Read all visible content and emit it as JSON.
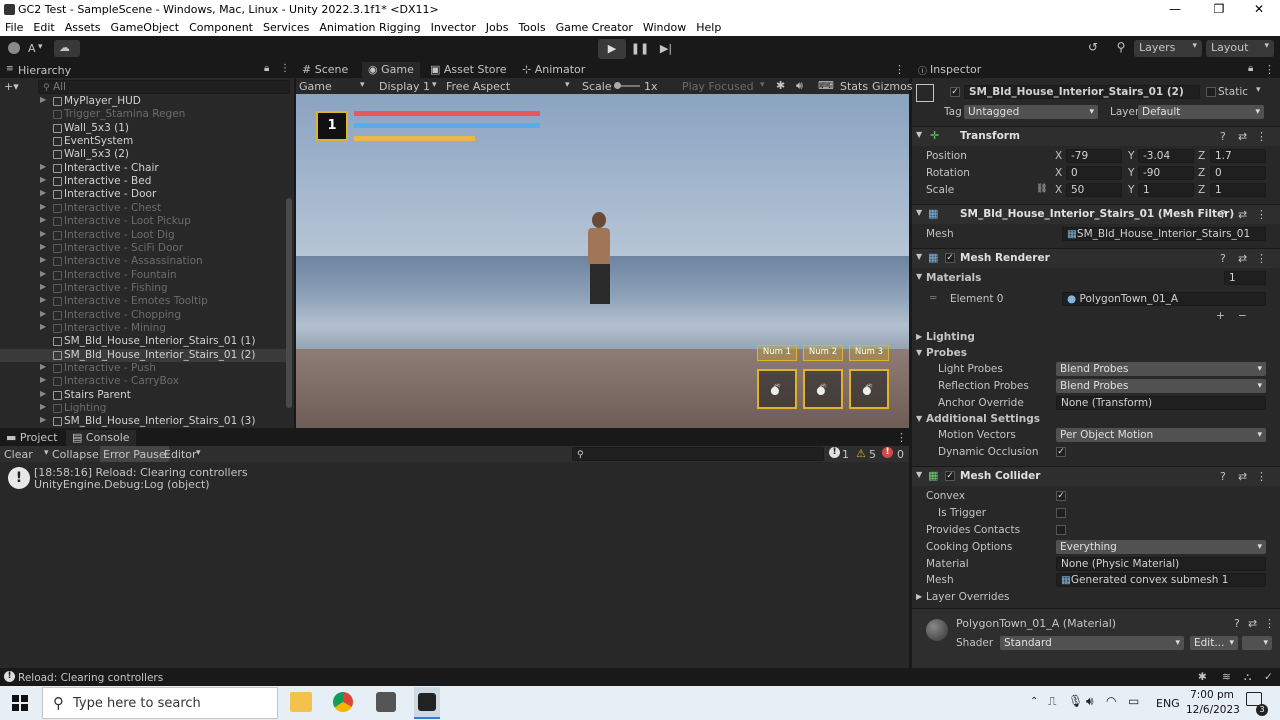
{
  "window": {
    "title": "GC2 Test - SampleScene - Windows, Mac, Linux - Unity 2022.3.1f1* <DX11>"
  },
  "menu": [
    "File",
    "Edit",
    "Assets",
    "GameObject",
    "Component",
    "Services",
    "Animation Rigging",
    "Invector",
    "Jobs",
    "Tools",
    "Game Creator",
    "Window",
    "Help"
  ],
  "toolbar": {
    "account": "A",
    "layers": "Layers",
    "layout": "Layout"
  },
  "hierarchy": {
    "title": "Hierarchy",
    "search_placeholder": "All",
    "items": [
      {
        "label": "MyPlayer_HUD",
        "state": "normal",
        "arrow": true
      },
      {
        "label": "Trigger_Stamina Regen",
        "state": "dim",
        "arrow": false
      },
      {
        "label": "Wall_5x3 (1)",
        "state": "normal",
        "arrow": false
      },
      {
        "label": "EventSystem",
        "state": "normal",
        "arrow": false
      },
      {
        "label": "Wall_5x3 (2)",
        "state": "normal",
        "arrow": false
      },
      {
        "label": "Interactive - Chair",
        "state": "normal",
        "arrow": true
      },
      {
        "label": "Interactive - Bed",
        "state": "normal",
        "arrow": true
      },
      {
        "label": "Interactive - Door",
        "state": "normal",
        "arrow": true
      },
      {
        "label": "Interactive - Chest",
        "state": "dim",
        "arrow": true
      },
      {
        "label": "Interactive - Loot Pickup",
        "state": "dim",
        "arrow": true
      },
      {
        "label": "Interactive - Loot Dig",
        "state": "dim",
        "arrow": true
      },
      {
        "label": "Interactive - SciFi Door",
        "state": "dim",
        "arrow": true
      },
      {
        "label": "Interactive - Assassination",
        "state": "dim",
        "arrow": true
      },
      {
        "label": "Interactive - Fountain",
        "state": "dim",
        "arrow": true
      },
      {
        "label": "Interactive - Fishing",
        "state": "dim",
        "arrow": true
      },
      {
        "label": "Interactive - Emotes Tooltip",
        "state": "dim",
        "arrow": true
      },
      {
        "label": "Interactive - Chopping",
        "state": "dim",
        "arrow": true
      },
      {
        "label": "Interactive - Mining",
        "state": "dim",
        "arrow": true
      },
      {
        "label": "SM_Bld_House_Interior_Stairs_01 (1)",
        "state": "normal",
        "arrow": false
      },
      {
        "label": "SM_Bld_House_Interior_Stairs_01 (2)",
        "state": "selected",
        "arrow": false
      },
      {
        "label": "Interactive - Push",
        "state": "dim",
        "arrow": true
      },
      {
        "label": "Interactive - CarryBox",
        "state": "dim",
        "arrow": true
      },
      {
        "label": "Stairs Parent",
        "state": "normal",
        "arrow": true
      },
      {
        "label": "Lighting",
        "state": "dim",
        "arrow": true
      },
      {
        "label": "SM_Bld_House_Interior_Stairs_01 (3)",
        "state": "normal",
        "arrow": true
      }
    ]
  },
  "center_tabs": [
    "Scene",
    "Game",
    "Asset Store",
    "Animator"
  ],
  "game_bar": {
    "game": "Game",
    "display": "Display 1",
    "aspect": "Free Aspect",
    "scale_label": "Scale",
    "scale_value": "1x",
    "play_focused": "Play Focused",
    "stats": "Stats",
    "gizmos": "Gizmos"
  },
  "hud": {
    "level": "1",
    "health": 1.0,
    "mana": 1.0,
    "stamina": 0.65,
    "hotkeys": [
      "Num 1",
      "Num 2",
      "Num 3"
    ]
  },
  "bottom_tabs": [
    "Project",
    "Console"
  ],
  "console": {
    "clear": "Clear",
    "collapse": "Collapse",
    "error_pause": "Error Pause",
    "editor": "Editor",
    "info_count": "1",
    "warn_count": "5",
    "error_count": "0",
    "entries": [
      {
        "line1": "[18:58:16] Reload: Clearing controllers",
        "line2": "UnityEngine.Debug:Log (object)"
      }
    ]
  },
  "inspector": {
    "title": "Inspector",
    "object_name": "SM_Bld_House_Interior_Stairs_01 (2)",
    "static": "Static",
    "tag_label": "Tag",
    "tag": "Untagged",
    "layer_label": "Layer",
    "layer": "Default",
    "transform": {
      "title": "Transform",
      "position": {
        "label": "Position",
        "x": "-79",
        "y": "-3.04",
        "z": "1.7"
      },
      "rotation": {
        "label": "Rotation",
        "x": "0",
        "y": "-90",
        "z": "0"
      },
      "scale": {
        "label": "Scale",
        "x": "50",
        "y": "1",
        "z": "1"
      }
    },
    "mesh_filter": {
      "title": "SM_Bld_House_Interior_Stairs_01 (Mesh Filter)",
      "mesh_label": "Mesh",
      "mesh": "SM_Bld_House_Interior_Stairs_01"
    },
    "mesh_renderer": {
      "title": "Mesh Renderer",
      "materials_label": "Materials",
      "materials_count": "1",
      "element0_label": "Element 0",
      "element0": "PolygonTown_01_A",
      "lighting": "Lighting",
      "probes": "Probes",
      "light_probes_label": "Light Probes",
      "light_probes": "Blend Probes",
      "reflection_probes_label": "Reflection Probes",
      "reflection_probes": "Blend Probes",
      "anchor_override_label": "Anchor Override",
      "anchor_override": "None (Transform)",
      "additional": "Additional Settings",
      "motion_vectors_label": "Motion Vectors",
      "motion_vectors": "Per Object Motion",
      "dynamic_occlusion_label": "Dynamic Occlusion"
    },
    "mesh_collider": {
      "title": "Mesh Collider",
      "convex_label": "Convex",
      "is_trigger_label": "Is Trigger",
      "provides_contacts_label": "Provides Contacts",
      "cooking_label": "Cooking Options",
      "cooking": "Everything",
      "material_label": "Material",
      "material": "None (Physic Material)",
      "mesh_label": "Mesh",
      "mesh": "Generated convex submesh 1",
      "layer_overrides": "Layer Overrides"
    },
    "material": {
      "title": "PolygonTown_01_A (Material)",
      "shader_label": "Shader",
      "shader": "Standard",
      "edit": "Edit..."
    }
  },
  "status": {
    "text": "Reload: Clearing controllers"
  },
  "taskbar": {
    "search_placeholder": "Type here to search",
    "lang": "ENG",
    "time": "7:00 pm",
    "date": "12/6/2023",
    "notif": "3"
  }
}
